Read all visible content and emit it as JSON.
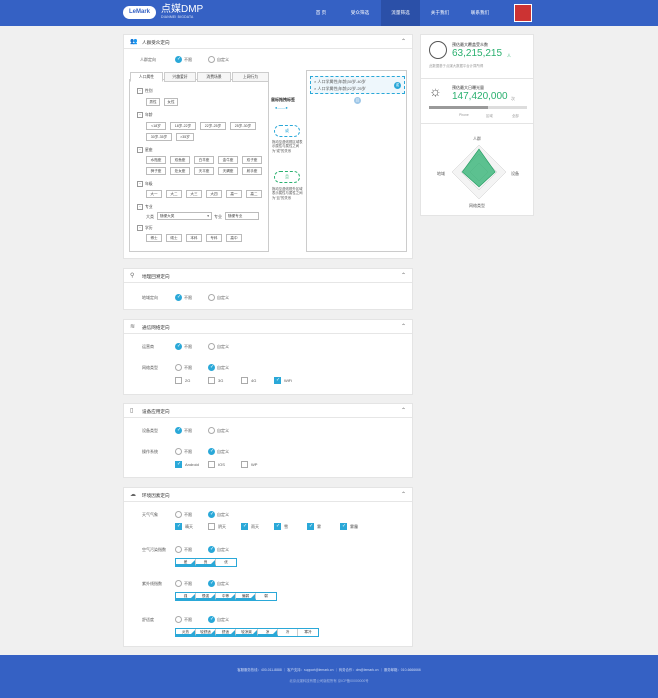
{
  "header": {
    "logo": "LeMark",
    "brand": "点媒DMP",
    "brand_sub": "DIANMEI BIGDATA",
    "nav": [
      "首 页",
      "受众筛选",
      "流量筛选",
      "关于我们",
      "联系我们"
    ],
    "active_nav": "流量筛选"
  },
  "crowd": {
    "title": "人群受众定向",
    "mode_label": "人群定向",
    "opt_unlimited": "不限",
    "opt_custom": "自定义",
    "tabs": [
      "人口属性",
      "兴趣爱好",
      "消费场景",
      "上网行为"
    ],
    "groups": [
      {
        "label": "性别",
        "tags": [
          "男性",
          "女性"
        ]
      },
      {
        "label": "年龄",
        "tags": [
          "<18岁",
          "18岁-22岁",
          "22岁-25岁",
          "25岁-30岁",
          "30岁-35岁",
          ">35岁"
        ]
      },
      {
        "label": "星座",
        "tags": [
          "水瓶座",
          "双鱼座",
          "白羊座",
          "金牛座",
          "双子座",
          "狮子座",
          "处女座",
          "天平座",
          "天蝎座",
          "射手座"
        ]
      },
      {
        "label": "年级",
        "tags": [
          "大一",
          "大二",
          "大三",
          "大四",
          "高一",
          "高二"
        ]
      },
      {
        "label": "专业",
        "tags": []
      },
      {
        "label": "学历",
        "tags": [
          "博士",
          "硕士",
          "本科",
          "专科",
          "高中"
        ]
      }
    ],
    "major_class_label": "大类",
    "major_class_value": "随便大类",
    "major_label": "专业",
    "major_value": "随便专业",
    "drag_title": "鼠标拖拽标签",
    "or_badge": "或",
    "or_desc": "拖动至虚线框区域表示属性与属性之间为“或”的关系",
    "and_badge": "且",
    "and_desc": "拖动至虚线框外区域表示属性与属性之间为“且”的关系",
    "selected": [
      "人口学属性|年龄|30岁-40岁",
      "人口学属性|年龄|22岁-25岁"
    ],
    "or_mark": "或",
    "and_mark": "且"
  },
  "stats": {
    "audience_label": "预估最大覆盖受众数",
    "audience_value": "63,215,215",
    "audience_unit": "人",
    "audience_note": "此数据基于点媒大数据平台计算所得",
    "traffic_label": "预估最大日曝光量",
    "traffic_value": "147,420,000",
    "traffic_unit": "次",
    "legend": [
      "Phone",
      "区域",
      "全部"
    ],
    "radar_axes": [
      "人群",
      "设备",
      "网络类型",
      "地域"
    ],
    "radar_values": [
      0.85,
      0.6,
      0.55,
      0.62
    ],
    "accent": "#2ab06f"
  },
  "geo": {
    "title": "地理回溯定向",
    "label": "地域定向",
    "opt_unlimited": "不限",
    "opt_custom": "自定义"
  },
  "network": {
    "title": "通信网络定向",
    "carrier_label": "运营商",
    "type_label": "网络类型",
    "opt_unlimited": "不限",
    "opt_custom": "自定义",
    "types": [
      "2G",
      "3G",
      "4G",
      "WiFi"
    ]
  },
  "device": {
    "title": "设备应用定向",
    "type_label": "设备类型",
    "os_label": "操作系统",
    "opt_unlimited": "不限",
    "opt_custom": "自定义",
    "os": [
      "Android",
      "IOS",
      "WP"
    ]
  },
  "env": {
    "title": "环境因素定向",
    "weather_label": "天气气象",
    "air_label": "空气污染指数",
    "uv_label": "紫外线指数",
    "comfort_label": "舒适度",
    "opt_unlimited": "不限",
    "opt_custom": "自定义",
    "weather": [
      "晴天",
      "阴天",
      "雨天",
      "雪",
      "雾",
      "雾霾"
    ],
    "air": [
      "差",
      "良",
      "优"
    ],
    "uv": [
      "强",
      "很强",
      "中等",
      "偏弱",
      "弱"
    ],
    "comfort": [
      "炎热",
      "较舒适",
      "舒适",
      "较凉爽",
      "凉",
      "冷",
      "寒冷"
    ]
  },
  "footer": {
    "line1": "客服服务热线：400-011-8888 ｜ 客户支持：support@lemark.cn ｜ 商务合作：dm@lemark.cn ｜ 服务邮箱：010-6666666",
    "line2": "北京点媒科技有限公司版权所有 京ICP备00000000号"
  }
}
